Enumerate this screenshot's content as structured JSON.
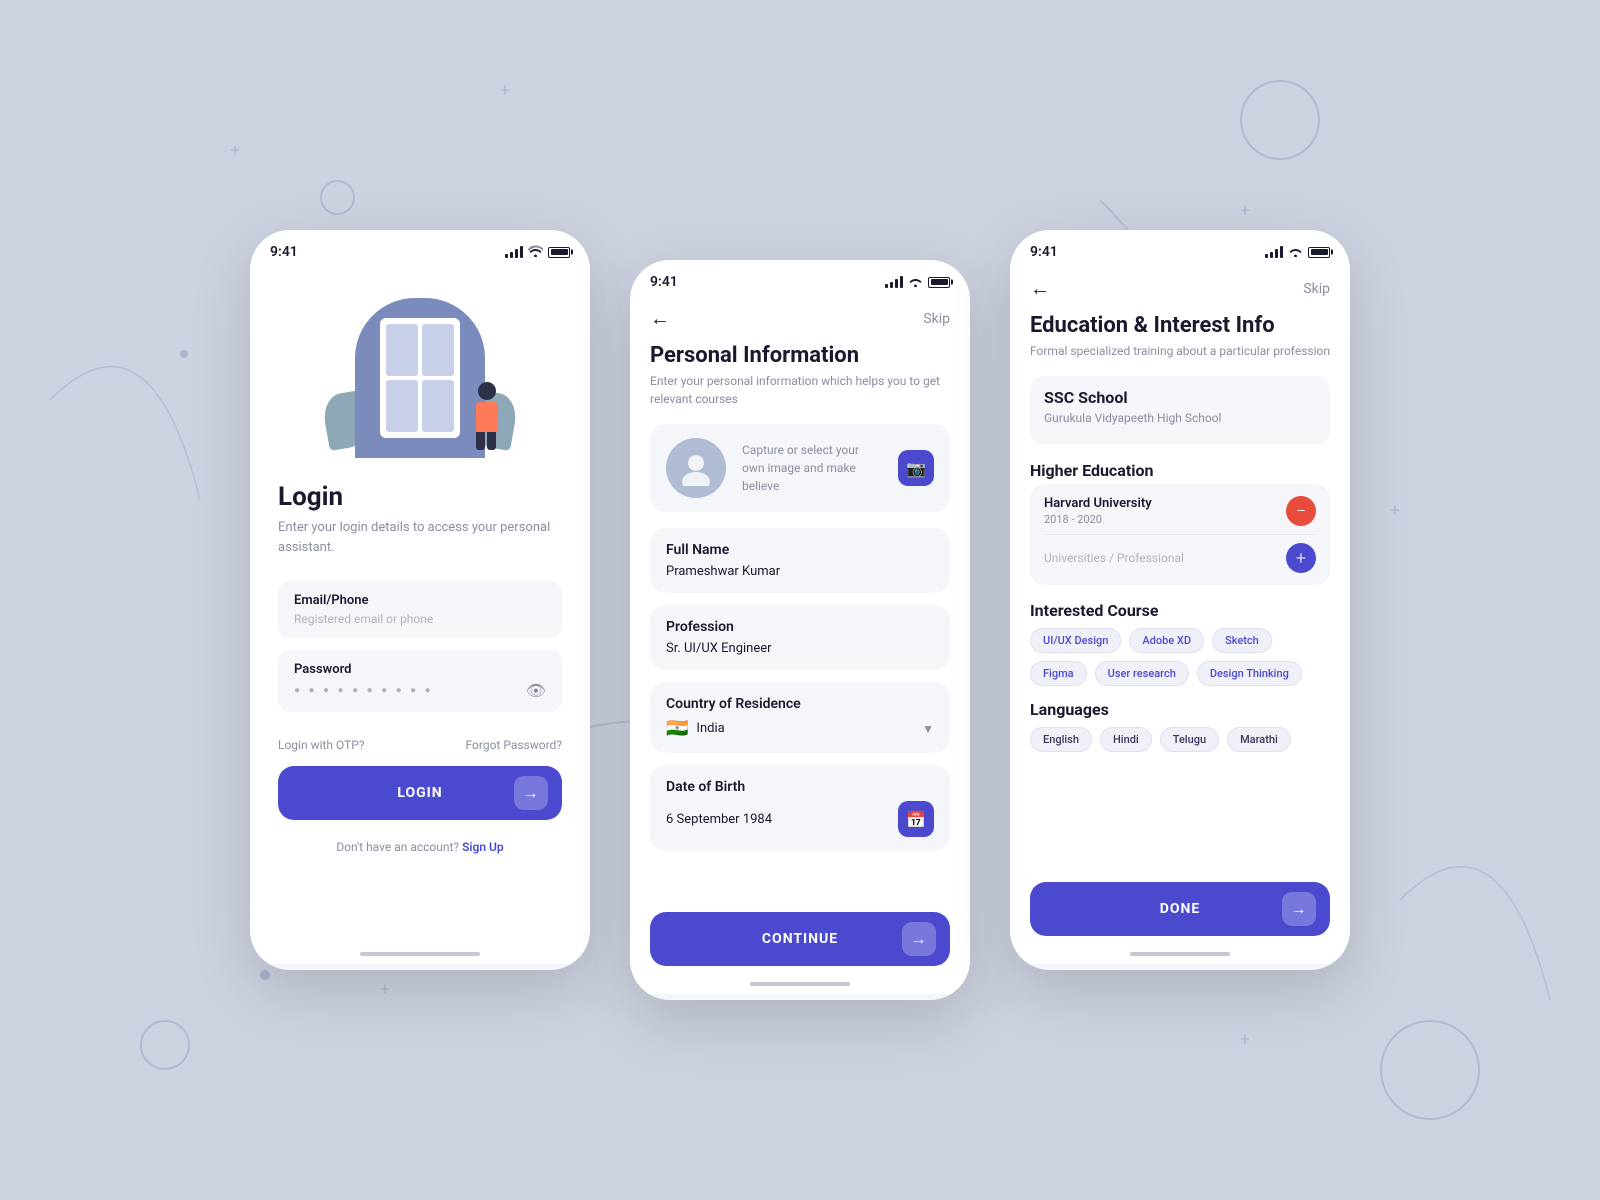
{
  "background": {
    "color": "#cdd2e0"
  },
  "phone1": {
    "status_time": "9:41",
    "title": "Login",
    "subtitle": "Enter your login details to access your personal assistant.",
    "email_label": "Email/Phone",
    "email_placeholder": "Registered email or phone",
    "password_label": "Password",
    "password_value": "••••••••••",
    "otp_label": "Login with OTP?",
    "forgot_label": "Forgot Password?",
    "login_button": "LOGIN",
    "signup_text": "Don't have an account?",
    "signup_link": "Sign Up"
  },
  "phone2": {
    "status_time": "9:41",
    "skip_label": "Skip",
    "title": "Personal Information",
    "subtitle": "Enter your personal information which helps you to get relevant courses",
    "avatar_text": "Capture or select your own image and make believe",
    "fullname_label": "Full Name",
    "fullname_value": "Prameshwar Kumar",
    "profession_label": "Profession",
    "profession_value": "Sr. UI/UX Engineer",
    "country_label": "Country of Residence",
    "country_value": "India",
    "dob_label": "Date of Birth",
    "dob_value": "6 September 1984",
    "continue_button": "CONTINUE"
  },
  "phone3": {
    "status_time": "9:41",
    "skip_label": "Skip",
    "title": "Education & Interest Info",
    "subtitle": "Formal specialized training about a particular profession",
    "ssc_section": "SSC School",
    "ssc_value": "Gurukula Vidyapeeth High School",
    "higher_section": "Higher Education",
    "university_name": "Harvard University",
    "university_years": "2018 - 2020",
    "add_placeholder": "Universities / Professional",
    "interested_title": "Interested Course",
    "tags": [
      "UI/UX Design",
      "Adobe XD",
      "Sketch",
      "Figma",
      "User research",
      "Design Thinking"
    ],
    "languages_title": "Languages",
    "languages": [
      "English",
      "Hindi",
      "Telugu",
      "Marathi"
    ],
    "done_button": "DONE"
  }
}
